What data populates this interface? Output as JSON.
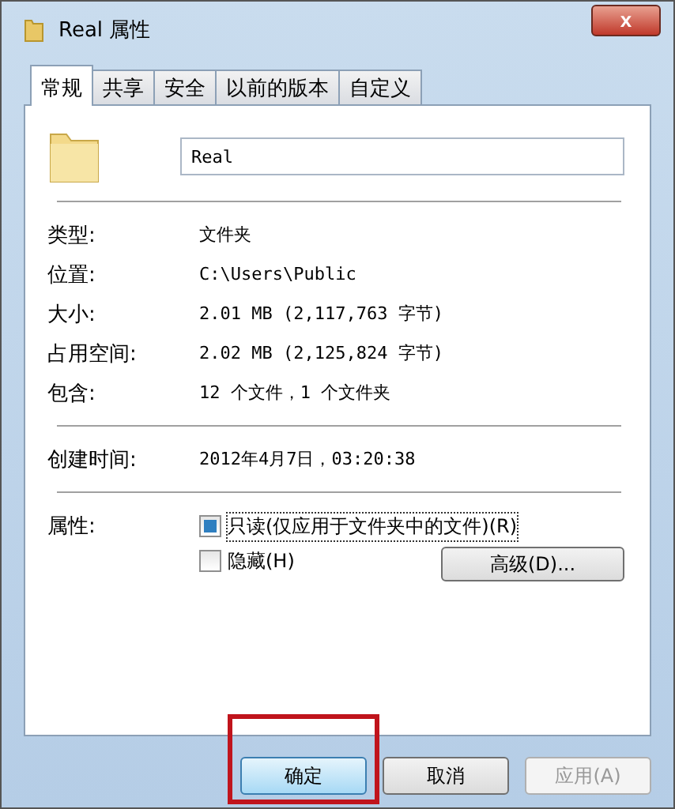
{
  "window": {
    "title": "Real 属性",
    "close": "x"
  },
  "tabs": [
    {
      "label": "常规",
      "selected": true
    },
    {
      "label": "共享",
      "selected": false
    },
    {
      "label": "安全",
      "selected": false
    },
    {
      "label": "以前的版本",
      "selected": false
    },
    {
      "label": "自定义",
      "selected": false
    }
  ],
  "name_field": {
    "value": "Real"
  },
  "info_groups": [
    [
      {
        "label": "类型:",
        "value": "文件夹"
      },
      {
        "label": "位置:",
        "value": "C:\\Users\\Public"
      },
      {
        "label": "大小:",
        "value": "2.01 MB (2,117,763 字节)"
      },
      {
        "label": "占用空间:",
        "value": "2.02 MB (2,125,824 字节)"
      },
      {
        "label": "包含:",
        "value": "12 个文件，1 个文件夹"
      }
    ],
    [
      {
        "label": "创建时间:",
        "value": "2012年4月7日，03:20:38"
      }
    ]
  ],
  "attributes": {
    "label": "属性:",
    "options": [
      {
        "label": "只读(仅应用于文件夹中的文件)(R)",
        "checked": false,
        "indeterminate": true,
        "focused": true
      },
      {
        "label": "隐藏(H)",
        "checked": false,
        "indeterminate": false,
        "focused": false
      }
    ],
    "advanced_button": "高级(D)..."
  },
  "buttons": [
    {
      "label": "确定",
      "default": true,
      "disabled": false,
      "highlighted": true
    },
    {
      "label": "取消",
      "default": false,
      "disabled": false,
      "highlighted": false
    },
    {
      "label": "应用(A)",
      "default": false,
      "disabled": true,
      "highlighted": false
    }
  ]
}
